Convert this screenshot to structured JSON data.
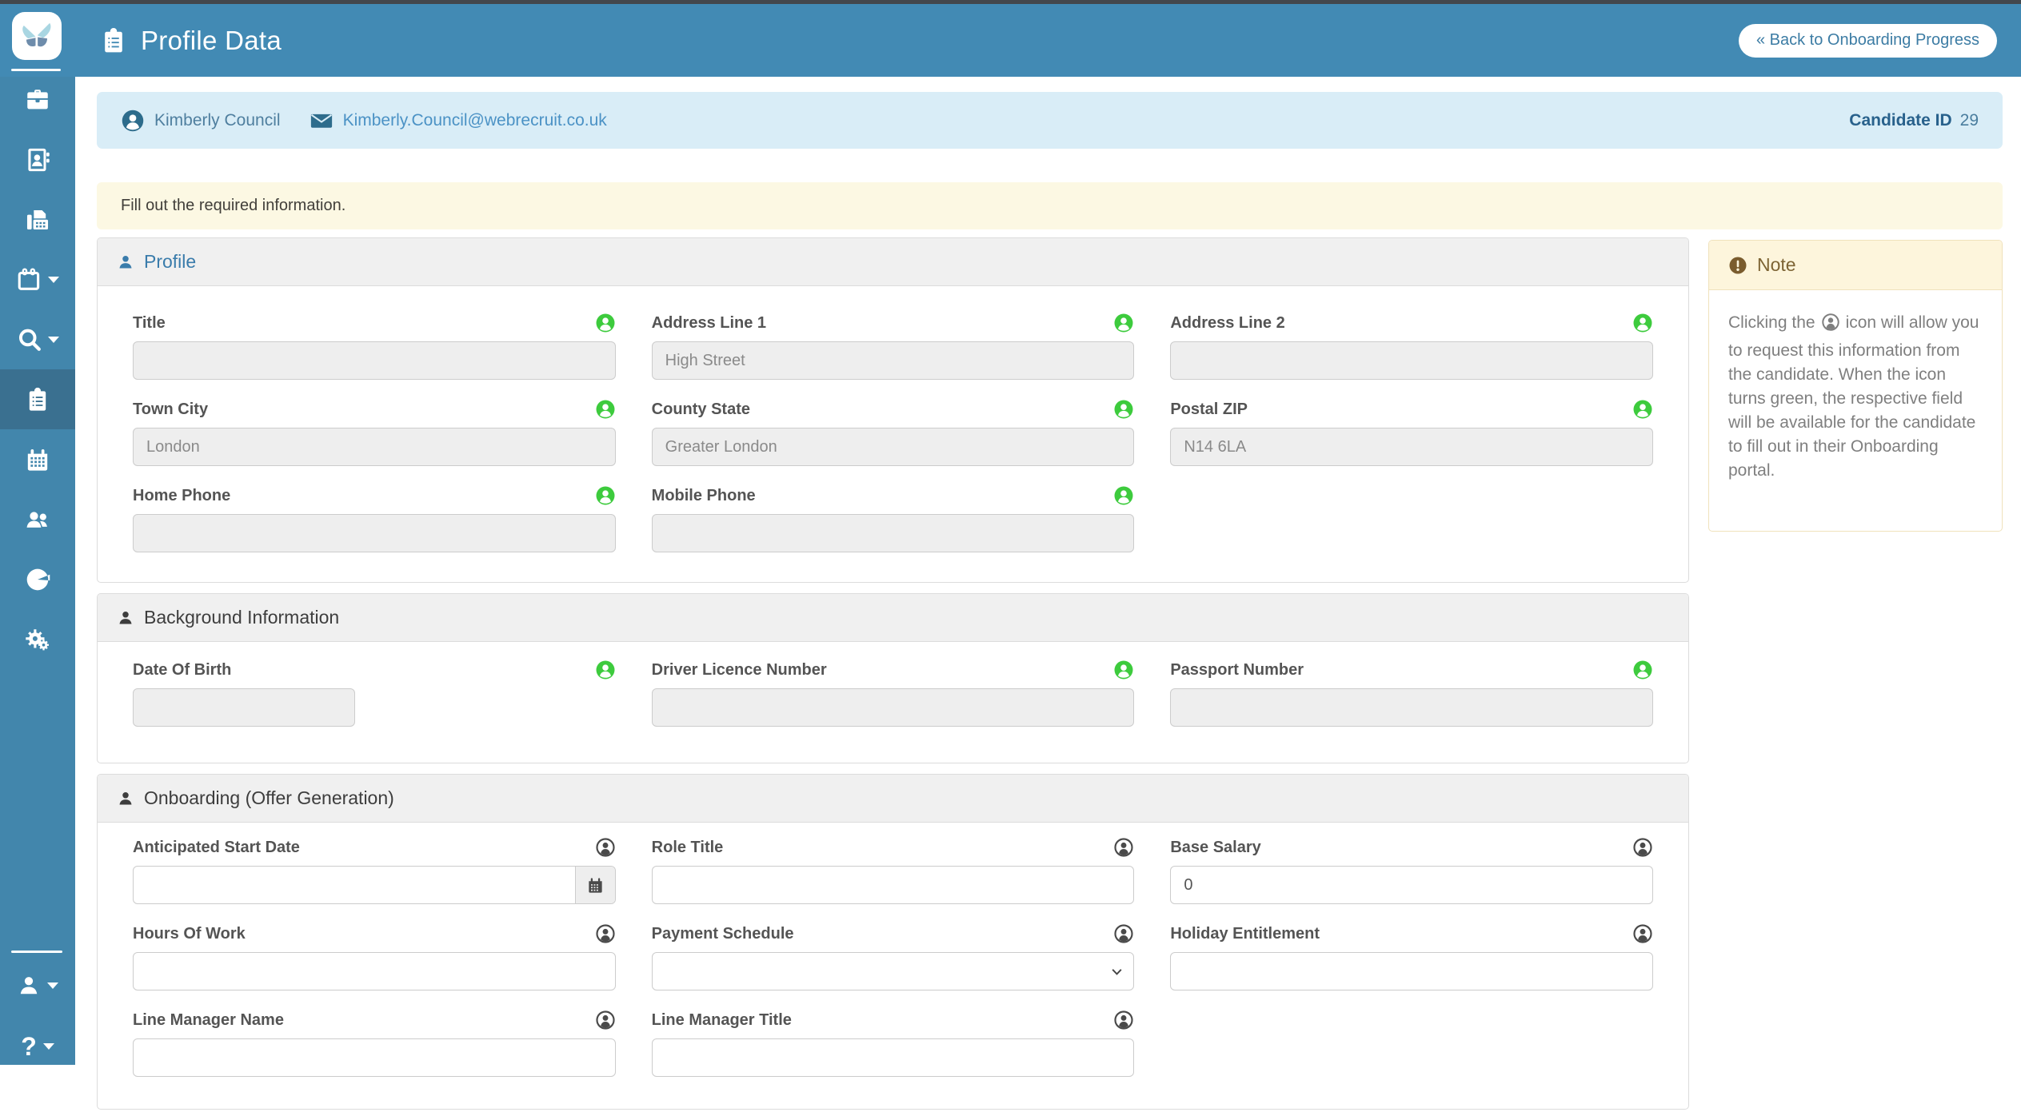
{
  "app": {
    "title": "Profile Data",
    "back_button": "« Back to Onboarding Progress"
  },
  "candidate": {
    "name": "Kimberly Council",
    "email": "Kimberly.Council@webrecruit.co.uk",
    "id_label": "Candidate ID",
    "id": "29"
  },
  "alert": {
    "text": "Fill out the required information."
  },
  "sidebar": {
    "items": [
      {
        "name": "jobs-briefcase"
      },
      {
        "name": "contacts-address-book"
      },
      {
        "name": "fax-documents"
      },
      {
        "name": "calendar-menu"
      },
      {
        "name": "search-menu"
      },
      {
        "name": "onboarding-clipboard",
        "active": true
      },
      {
        "name": "calendar-grid"
      },
      {
        "name": "users"
      },
      {
        "name": "reports-pie"
      },
      {
        "name": "settings-gears"
      },
      {
        "name": "account-user"
      },
      {
        "name": "help"
      }
    ]
  },
  "panels": {
    "profile": {
      "title": "Profile",
      "fields": [
        {
          "label": "Title",
          "value": "",
          "icon_state": "green"
        },
        {
          "label": "Address Line 1",
          "value": "High Street",
          "icon_state": "green"
        },
        {
          "label": "Address Line 2",
          "value": "",
          "icon_state": "green"
        },
        {
          "label": "Town City",
          "value": "London",
          "icon_state": "green"
        },
        {
          "label": "County State",
          "value": "Greater London",
          "icon_state": "green"
        },
        {
          "label": "Postal ZIP",
          "value": "N14 6LA",
          "icon_state": "green"
        },
        {
          "label": "Home Phone",
          "value": "",
          "icon_state": "green"
        },
        {
          "label": "Mobile Phone",
          "value": "",
          "icon_state": "green"
        }
      ]
    },
    "background": {
      "title": "Background Information",
      "fields": [
        {
          "label": "Date Of Birth",
          "value": "",
          "icon_state": "green"
        },
        {
          "label": "Driver Licence Number",
          "value": "",
          "icon_state": "green"
        },
        {
          "label": "Passport Number",
          "value": "",
          "icon_state": "green"
        }
      ]
    },
    "onboarding": {
      "title": "Onboarding (Offer Generation)",
      "fields": [
        {
          "label": "Anticipated Start Date",
          "value": "",
          "icon_state": "dark"
        },
        {
          "label": "Role Title",
          "value": "",
          "icon_state": "dark"
        },
        {
          "label": "Base Salary",
          "value": "0",
          "icon_state": "dark"
        },
        {
          "label": "Hours Of Work",
          "value": "",
          "icon_state": "dark"
        },
        {
          "label": "Payment Schedule",
          "value": "",
          "icon_state": "dark"
        },
        {
          "label": "Holiday Entitlement",
          "value": "",
          "icon_state": "dark"
        },
        {
          "label": "Line Manager Name",
          "value": "",
          "icon_state": "dark"
        },
        {
          "label": "Line Manager Title",
          "value": "",
          "icon_state": "dark"
        }
      ]
    }
  },
  "note": {
    "title": "Note",
    "p1": "Clicking the",
    "p2": "icon will allow you to request this information from the candidate. When the icon turns green, the respective field will be available for the candidate to fill out in their Onboarding portal."
  },
  "colors": {
    "header_blue": "#428ab4",
    "sidebar_blue": "#4286ac",
    "sidebar_active": "#3a7090",
    "info_bg": "#d9edf7",
    "alert_bg": "#fcf8e3",
    "green_icon": "#3dcb3d",
    "dark_icon": "#4a4a4a",
    "note_head_bg": "#fdf5dc",
    "note_text": "#7d6434",
    "profile_head_text": "#3a7cab"
  }
}
